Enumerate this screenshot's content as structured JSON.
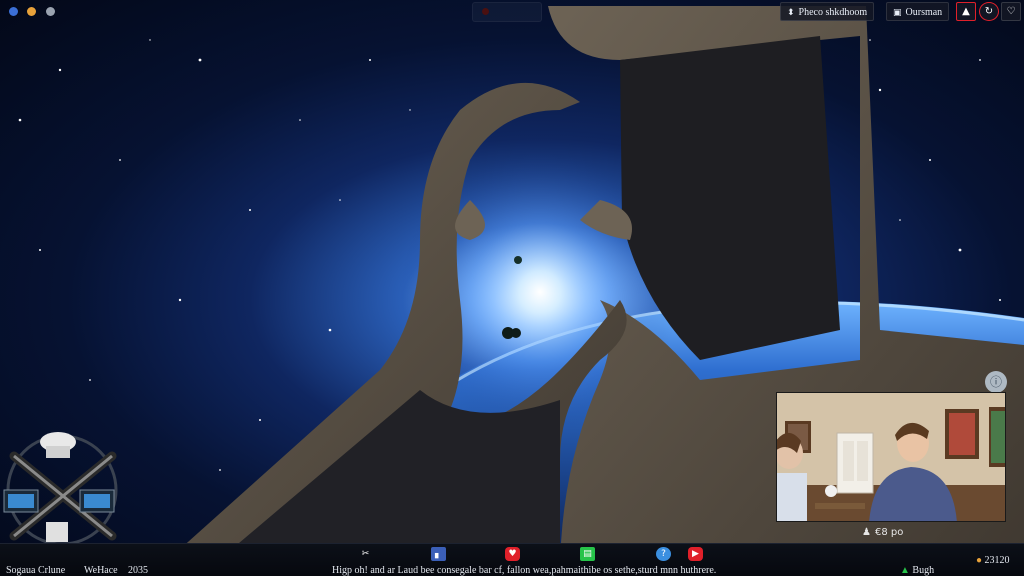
{
  "top_bar": {
    "share_button_label": "Pheco shkdhoom",
    "share_icon": "pin-icon",
    "view_button_label": "Oursman",
    "view_icon": "window-icon",
    "mic_icon": "microphone-icon",
    "settings_icon": "refresh-icon",
    "chat_icon": "chat-bubble-icon"
  },
  "video_panel": {
    "camera_label": "€8 po",
    "info_icon": "info-icon"
  },
  "bottom_bar": {
    "left_label": "Sogaua Crlune",
    "left_sublabel": "WeHace",
    "year": "2035",
    "status_text": "Higp oh! and ar Laud bee consegale bar cf, fallon wea,pahmaithibe os sethe,sturd mnn huthrere.",
    "right_label": "Bugh",
    "clock": "23120"
  },
  "colors": {
    "accent_red": "#e0202a",
    "accent_green": "#27c44a",
    "accent_blue": "#3b6fd6"
  }
}
